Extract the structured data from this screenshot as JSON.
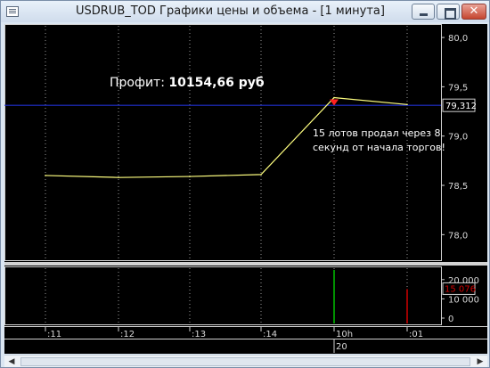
{
  "window": {
    "title": "USDRUB_TOD Графики цены и объема - [1 минута]"
  },
  "annotations": {
    "profit_label": "Профит:",
    "profit_value": "10154,66 руб",
    "note": "15 лотов продал через 8 секунд от начала торгов!"
  },
  "price_axis": {
    "ticks": [
      "80,0",
      "79,5",
      "79,0",
      "78,5",
      "78,0"
    ],
    "current_price": "79,312"
  },
  "volume_axis": {
    "ticks": [
      "20 000",
      "10 000",
      "0"
    ],
    "current_volume": "15 076"
  },
  "time_axis": {
    "ticks": [
      ":11",
      ":12",
      ":13",
      ":14",
      "10h",
      ":01"
    ],
    "date_label": "20"
  },
  "colors": {
    "price_line": "#ffff80",
    "level_line": "#2030d0",
    "volume_up": "#00c000",
    "volume_down": "#d00000",
    "marker": "#ff2020"
  },
  "icons": [
    "app-chart-icon",
    "minimize-icon",
    "maximize-icon",
    "close-icon",
    "scroll-left-icon",
    "scroll-right-icon"
  ],
  "chart_data": [
    {
      "type": "line",
      "x": [
        ":11",
        ":12",
        ":13",
        ":14",
        "10h",
        ":01"
      ],
      "series": [
        {
          "values": [
            78.6,
            78.58,
            78.59,
            78.61,
            79.39,
            79.32
          ]
        }
      ],
      "ylim": [
        77.75,
        80.1
      ],
      "reference_line": 79.312,
      "marker_at": "10h"
    },
    {
      "type": "bar",
      "categories": [
        ":11",
        ":12",
        ":13",
        ":14",
        "10h",
        ":01"
      ],
      "values": [
        0,
        0,
        0,
        0,
        25000,
        15076
      ],
      "ylim": [
        0,
        25000
      ]
    }
  ]
}
